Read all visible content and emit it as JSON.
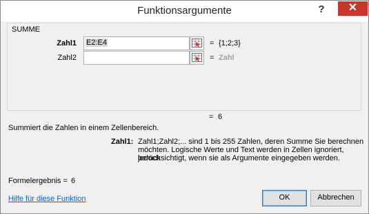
{
  "window": {
    "title": "Funktionsargumente",
    "help_label": "?",
    "close_label": "✕"
  },
  "function": {
    "name": "SUMME",
    "args": [
      {
        "label": "Zahl1",
        "value": "E2:E4",
        "result": "{1;2;3}"
      },
      {
        "label": "Zahl2",
        "value": "",
        "result": "Zahl"
      }
    ],
    "equals": "=",
    "total_result": "6"
  },
  "description": "Summiert die Zahlen in einem Zellenbereich.",
  "arg_help": {
    "label": "Zahl1:",
    "text_line1": "Zahl1;Zahl2;... sind 1 bis 255 Zahlen, deren Summe Sie berechnen",
    "text_line2": "möchten. Logische Werte und Text werden in Zellen ignoriert, jedoch",
    "text_line3": "berücksichtigt, wenn sie als Argumente eingegeben werden."
  },
  "formula_result": {
    "label": "Formelergebnis =",
    "value": "6"
  },
  "footer": {
    "help_link": "Hilfe für diese Funktion",
    "ok_label": "OK",
    "cancel_label": "Abbrechen"
  }
}
